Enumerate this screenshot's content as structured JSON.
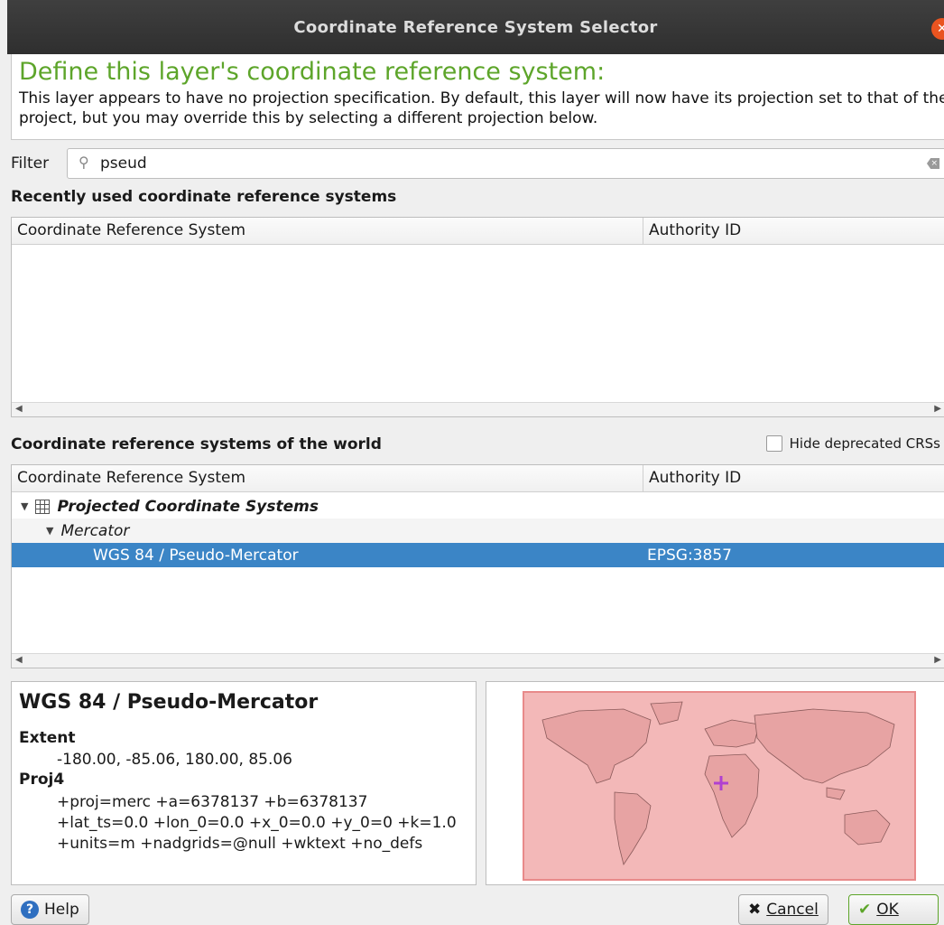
{
  "window": {
    "title": "Coordinate Reference System Selector"
  },
  "header": {
    "heading": "Define this layer's coordinate reference system:",
    "description": "This layer appears to have no projection specification. By default, this layer will now have its projection set to that of the project, but you may override this by selecting a different projection below."
  },
  "filter": {
    "label": "Filter",
    "value": "pseud"
  },
  "recent": {
    "section_title": "Recently used coordinate reference systems",
    "columns": [
      "Coordinate Reference System",
      "Authority ID"
    ]
  },
  "world": {
    "section_title": "Coordinate reference systems of the world",
    "hide_deprecated_label": "Hide deprecated CRSs",
    "columns": [
      "Coordinate Reference System",
      "Authority ID"
    ],
    "tree": {
      "group": "Projected Coordinate Systems",
      "subgroup": "Mercator",
      "selected": {
        "name": "WGS 84 / Pseudo-Mercator",
        "authority_id": "EPSG:3857"
      }
    }
  },
  "info": {
    "name": "WGS 84 / Pseudo-Mercator",
    "extent_label": "Extent",
    "extent_value": "-180.00, -85.06, 180.00, 85.06",
    "proj4_label": "Proj4",
    "proj4_lines": [
      "+proj=merc +a=6378137 +b=6378137",
      "+lat_ts=0.0 +lon_0=0.0 +x_0=0.0 +y_0=0 +k=1.0",
      "+units=m +nadgrids=@null +wktext +no_defs"
    ]
  },
  "buttons": {
    "help": "Help",
    "cancel": "Cancel",
    "ok": "OK"
  },
  "colors": {
    "heading": "#5da52a",
    "selection": "#3b85c6",
    "extent_fill": "#f3b8b8",
    "marker": "#b040d0"
  }
}
